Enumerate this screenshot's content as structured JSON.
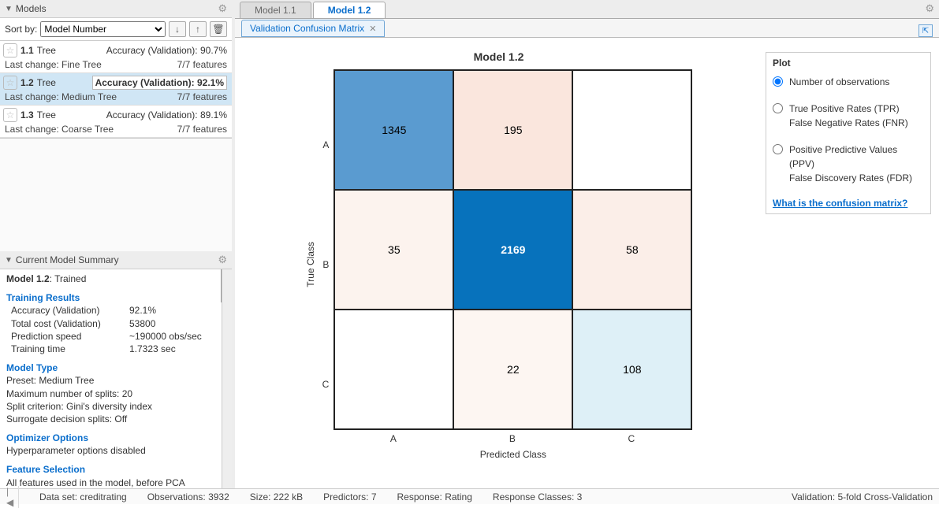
{
  "panels": {
    "models_title": "Models",
    "summary_title": "Current Model Summary"
  },
  "sort": {
    "label": "Sort by:",
    "selected": "Model Number"
  },
  "models": [
    {
      "id": "1.1",
      "type": "Tree",
      "acc_label": "Accuracy (Validation):",
      "acc": "90.7%",
      "change": "Last change: Fine Tree",
      "features": "7/7 features",
      "selected": false
    },
    {
      "id": "1.2",
      "type": "Tree",
      "acc_label": "Accuracy (Validation):",
      "acc": "92.1%",
      "change": "Last change: Medium Tree",
      "features": "7/7 features",
      "selected": true
    },
    {
      "id": "1.3",
      "type": "Tree",
      "acc_label": "Accuracy (Validation):",
      "acc": "89.1%",
      "change": "Last change: Coarse Tree",
      "features": "7/7 features",
      "selected": false
    }
  ],
  "summary": {
    "name": "Model 1.2",
    "status": ": Trained",
    "training_h": "Training Results",
    "acc_k": "Accuracy (Validation)",
    "acc_v": "92.1%",
    "cost_k": "Total cost (Validation)",
    "cost_v": "53800",
    "speed_k": "Prediction speed",
    "speed_v": "~190000 obs/sec",
    "time_k": "Training time",
    "time_v": "1.7323 sec",
    "type_h": "Model Type",
    "preset": "Preset: Medium Tree",
    "splits": "Maximum number of splits: 20",
    "crit": "Split criterion: Gini's diversity index",
    "surr": "Surrogate decision splits: Off",
    "opt_h": "Optimizer Options",
    "opt_v": "Hyperparameter options disabled",
    "fs_h": "Feature Selection",
    "fs_v": "All features used in the model, before PCA"
  },
  "tabs": {
    "t1": "Model 1.1",
    "t2": "Model 1.2",
    "sub": "Validation Confusion Matrix"
  },
  "chart_data": {
    "type": "heatmap",
    "title": "Model 1.2",
    "xlabel": "Predicted Class",
    "ylabel": "True Class",
    "categories": [
      "A",
      "B",
      "C"
    ],
    "matrix": [
      [
        1345,
        195,
        null
      ],
      [
        35,
        2169,
        58
      ],
      [
        null,
        22,
        108
      ]
    ],
    "colors": [
      [
        "#5a9bd0",
        "#fae6dd",
        "#ffffff"
      ],
      [
        "#fcf3ee",
        "#0772bc",
        "#fbeee8"
      ],
      [
        "#ffffff",
        "#fdf6f2",
        "#def0f7"
      ]
    ],
    "text_colors": [
      [
        "#000",
        "#000",
        "#000"
      ],
      [
        "#000",
        "#fff",
        "#000"
      ],
      [
        "#000",
        "#000",
        "#000"
      ]
    ]
  },
  "plot_options": {
    "header": "Plot",
    "opt1": "Number of observations",
    "opt2a": "True Positive Rates (TPR)",
    "opt2b": "False Negative Rates (FNR)",
    "opt3a": "Positive Predictive Values (PPV)",
    "opt3b": "False Discovery Rates (FDR)",
    "link": "What is the confusion matrix?"
  },
  "status": {
    "ds": "Data set: creditrating",
    "obs": "Observations: 3932",
    "size": "Size: 222 kB",
    "pred": "Predictors: 7",
    "resp": "Response: Rating",
    "rc": "Response Classes: 3",
    "val": "Validation: 5-fold Cross-Validation"
  }
}
